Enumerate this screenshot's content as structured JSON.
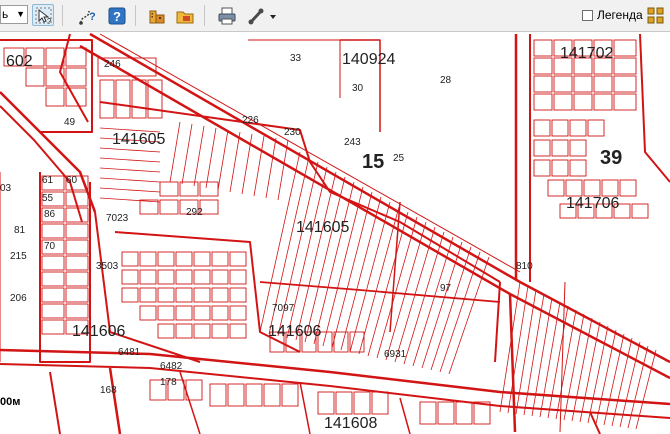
{
  "toolbar": {
    "scale_value": "ь",
    "legend_label": "Легенда",
    "legend_checked": false,
    "buttons": [
      {
        "icon": "select-info-icon",
        "active": true
      },
      {
        "icon": "route-query-icon",
        "active": false
      },
      {
        "icon": "help-query-icon",
        "active": false
      },
      {
        "icon": "building-icon",
        "active": false
      },
      {
        "icon": "folder-icon",
        "active": false
      },
      {
        "icon": "print-icon",
        "active": false
      },
      {
        "icon": "measure-tool-icon",
        "active": false
      }
    ]
  },
  "map": {
    "scale_text": "00м",
    "labels": [
      {
        "text": "602"
      },
      {
        "text": "246"
      },
      {
        "text": "33"
      },
      {
        "text": "140924"
      },
      {
        "text": "28"
      },
      {
        "text": "141702"
      },
      {
        "text": "15"
      },
      {
        "text": "39"
      },
      {
        "text": "141706"
      },
      {
        "text": "141605"
      },
      {
        "text": "141605"
      },
      {
        "text": "141606"
      },
      {
        "text": "141606"
      },
      {
        "text": "141608"
      },
      {
        "text": "7023"
      },
      {
        "text": "3503"
      },
      {
        "text": "7097"
      },
      {
        "text": "6931"
      },
      {
        "text": "6481"
      },
      {
        "text": "6482"
      },
      {
        "text": "292"
      },
      {
        "text": "243"
      },
      {
        "text": "25"
      },
      {
        "text": "30"
      },
      {
        "text": "810"
      },
      {
        "text": "230"
      },
      {
        "text": "226"
      },
      {
        "text": "215"
      },
      {
        "text": "206"
      },
      {
        "text": "178"
      },
      {
        "text": "168"
      },
      {
        "text": "97"
      },
      {
        "text": "55"
      },
      {
        "text": "81"
      },
      {
        "text": "70"
      },
      {
        "text": "61"
      },
      {
        "text": "60"
      },
      {
        "text": "86"
      },
      {
        "text": "49"
      },
      {
        "text": "03"
      }
    ]
  }
}
